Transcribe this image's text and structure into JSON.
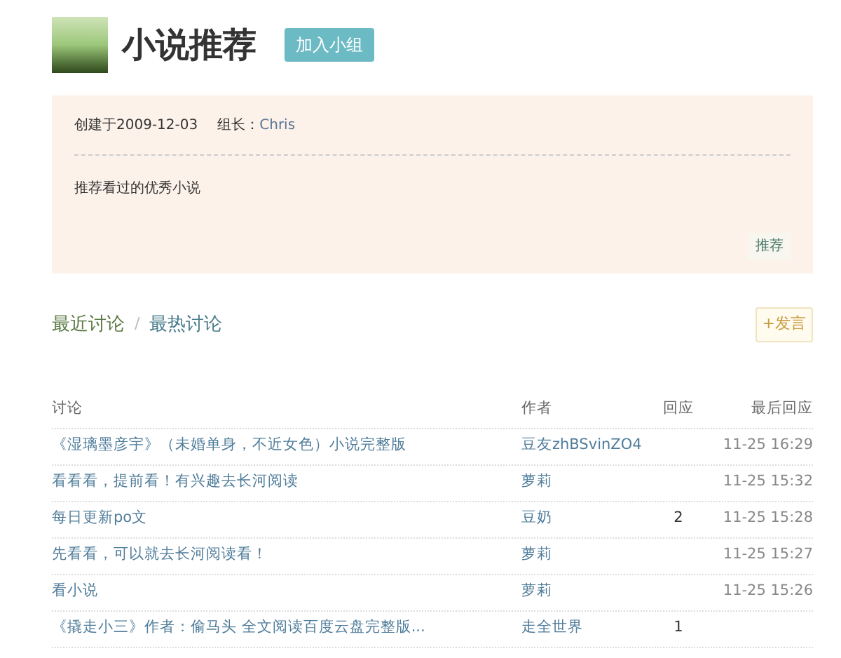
{
  "group": {
    "name": "小说推荐",
    "join_button": "加入小组"
  },
  "info": {
    "created": "创建于2009-12-03",
    "owner_label": "组长：",
    "owner": "Chris",
    "description": "推荐看过的优秀小说",
    "recommend_button": "推荐"
  },
  "tabs": [
    {
      "label": "最近讨论",
      "selected": true
    },
    {
      "label": "最热讨论",
      "selected": false
    }
  ],
  "tab_separator": "/",
  "post_button": "+发言",
  "table": {
    "columns": [
      "讨论",
      "作者",
      "回应",
      "最后回应"
    ],
    "rows": [
      {
        "title": "《湿璃墨彦宇》（未婚单身，不近女色）小说完整版",
        "author": "豆友zhBSvinZO4",
        "replies": "",
        "time": "11-25 16:29"
      },
      {
        "title": "看看看，提前看！有兴趣去长河阅读",
        "author": "萝莉",
        "replies": "",
        "time": "11-25 15:32"
      },
      {
        "title": "每日更新po文",
        "author": "豆奶",
        "replies": "2",
        "time": "11-25 15:28"
      },
      {
        "title": "先看看，可以就去长河阅读看！",
        "author": "萝莉",
        "replies": "",
        "time": "11-25 15:27"
      },
      {
        "title": "看小说",
        "author": "萝莉",
        "replies": "",
        "time": "11-25 15:26"
      },
      {
        "title": "《撬走小三》作者：偷马头 全文阅读百度云盘完整版...",
        "author": "走全世界",
        "replies": "1",
        "time": ""
      }
    ]
  }
}
